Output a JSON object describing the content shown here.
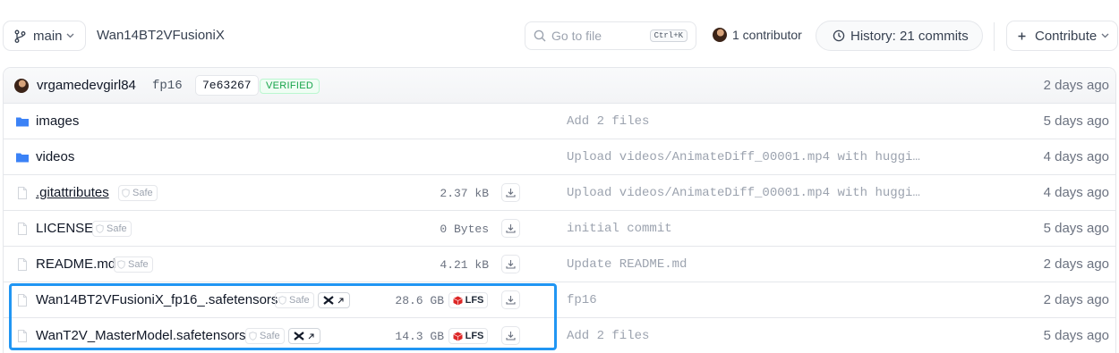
{
  "toolbar": {
    "branch": "main",
    "repo_name": "Wan14BT2VFusioniX",
    "search": {
      "placeholder": "Go to file",
      "shortcut": "Ctrl+K"
    },
    "contributors": "1 contributor",
    "history": "History: 21 commits",
    "contribute": "Contribute"
  },
  "last_commit": {
    "author": "vrgamedevgirl84",
    "branch": "fp16",
    "hash": "7e63267",
    "verified": "VERIFIED",
    "time": "2 days ago"
  },
  "files": [
    {
      "type": "folder",
      "name": "images",
      "message": "Add 2 files",
      "time": "5 days ago"
    },
    {
      "type": "folder",
      "name": "videos",
      "message": "Upload videos/AnimateDiff_00001.mp4 with huggi…",
      "time": "4 days ago"
    },
    {
      "type": "file",
      "name": ".gitattributes",
      "safe": "Safe",
      "size": "2.37 kB",
      "message": "Upload videos/AnimateDiff_00001.mp4 with huggi…",
      "time": "4 days ago"
    },
    {
      "type": "file",
      "name": "LICENSE",
      "safe": "Safe",
      "size": "0 Bytes",
      "message": "initial commit",
      "time": "5 days ago"
    },
    {
      "type": "file",
      "name": "README.md",
      "safe": "Safe",
      "size": "4.21 kB",
      "message": "Update README.md",
      "time": "2 days ago"
    },
    {
      "type": "file",
      "name": "Wan14BT2VFusioniX_fp16_.safetensors",
      "safe": "Safe",
      "size": "28.6 GB",
      "lfs": "LFS",
      "message": "fp16",
      "time": "2 days ago"
    },
    {
      "type": "file",
      "name": "WanT2V_MasterModel.safetensors",
      "safe": "Safe",
      "size": "14.3 GB",
      "lfs": "LFS",
      "message": "Add 2 files",
      "time": "5 days ago"
    }
  ],
  "colors": {
    "folder": "#3b82f6",
    "highlight": "#2196f3",
    "verified": "#16a34a",
    "lfs": "#dc2626"
  }
}
